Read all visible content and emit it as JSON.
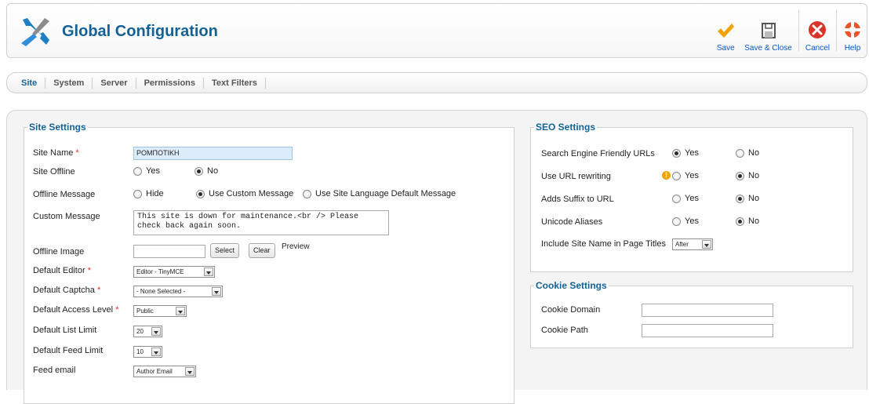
{
  "header": {
    "title": "Global Configuration",
    "logo_icon": "tools-icon",
    "toolbar": [
      {
        "label": "Save",
        "icon": "check-icon",
        "color": "#f0a30a"
      },
      {
        "label": "Save & Close",
        "icon": "floppy-disk-icon",
        "color": "#555555"
      },
      {
        "label": "Cancel",
        "icon": "cancel-icon",
        "color": "#d8342a"
      },
      {
        "label": "Help",
        "icon": "lifebuoy-icon",
        "color": "#e8552b"
      }
    ]
  },
  "tabs": [
    "Site",
    "System",
    "Server",
    "Permissions",
    "Text Filters"
  ],
  "active_tab": "Site",
  "site_settings": {
    "legend": "Site Settings",
    "site_name": {
      "label": "Site Name",
      "required": "*",
      "value": "ΡΟΜΠΟΤΙΚΗ"
    },
    "site_offline": {
      "label": "Site Offline",
      "options": [
        "Yes",
        "No"
      ],
      "selected": "No"
    },
    "offline_message": {
      "label": "Offline Message",
      "options": [
        "Hide",
        "Use Custom Message",
        "Use Site Language Default Message"
      ],
      "selected": "Use Custom Message"
    },
    "custom_message": {
      "label": "Custom Message",
      "line1": "This site is down for maintenance.<br /> Please",
      "line2": "check back again soon."
    },
    "offline_image": {
      "label": "Offline Image",
      "value": "",
      "select_label": "Select",
      "clear_label": "Clear",
      "preview_label": "Preview"
    },
    "default_editor": {
      "label": "Default Editor",
      "required": "*",
      "value": "Editor - TinyMCE"
    },
    "default_captcha": {
      "label": "Default Captcha",
      "required": "*",
      "value": "- None Selected -"
    },
    "default_access_level": {
      "label": "Default Access Level",
      "required": "*",
      "value": "Public"
    },
    "default_list_limit": {
      "label": "Default List Limit",
      "value": "20"
    },
    "default_feed_limit": {
      "label": "Default Feed Limit",
      "value": "10"
    },
    "feed_email": {
      "label": "Feed email",
      "value": "Author Email"
    }
  },
  "seo_settings": {
    "legend": "SEO Settings",
    "sef_urls": {
      "label": "Search Engine Friendly URLs",
      "options": [
        "Yes",
        "No"
      ],
      "selected": "Yes"
    },
    "url_rewriting": {
      "label": "Use URL rewriting",
      "options": [
        "Yes",
        "No"
      ],
      "selected": "No",
      "warning_icon": "warning-icon"
    },
    "adds_suffix": {
      "label": "Adds Suffix to URL",
      "options": [
        "Yes",
        "No"
      ],
      "selected": "No"
    },
    "unicode_aliases": {
      "label": "Unicode Aliases",
      "options": [
        "Yes",
        "No"
      ],
      "selected": "No"
    },
    "site_name_titles": {
      "label": "Include Site Name in Page Titles",
      "value": "After"
    }
  },
  "cookie_settings": {
    "legend": "Cookie Settings",
    "cookie_domain": {
      "label": "Cookie Domain",
      "value": ""
    },
    "cookie_path": {
      "label": "Cookie Path",
      "value": ""
    }
  }
}
